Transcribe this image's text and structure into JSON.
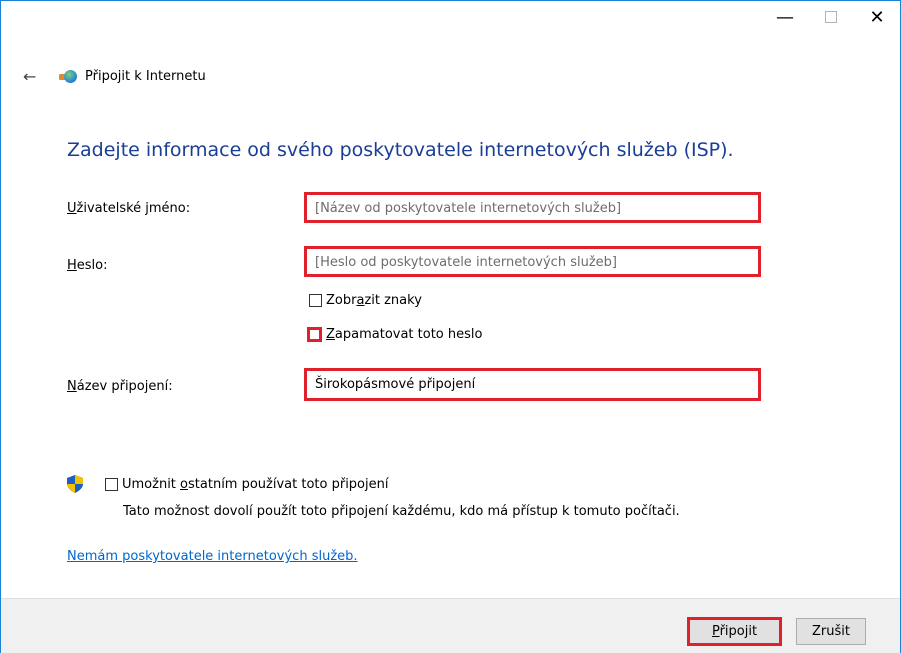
{
  "window": {
    "title": "Připojit k Internetu",
    "controls": {
      "minimize": "—",
      "close": "✕"
    }
  },
  "heading": "Zadejte informace od svého poskytovatele internetových služeb (ISP).",
  "form": {
    "username": {
      "label_access": "U",
      "label_rest": "živatelské jméno:",
      "placeholder": "[Název od poskytovatele internetových služeb]"
    },
    "password": {
      "label_access": "H",
      "label_rest": "eslo:",
      "placeholder": "[Heslo od poskytovatele internetových služeb]"
    },
    "show_chars": {
      "label_pre": "Zobr",
      "label_access": "a",
      "label_post": "zit znaky"
    },
    "remember": {
      "label_access": "Z",
      "label_post": "apamatovat toto heslo"
    },
    "connection_name": {
      "label_access": "N",
      "label_rest": "ázev připojení:",
      "value": "Širokopásmové připojení"
    }
  },
  "allow_others": {
    "label_pre": "Umožnit ",
    "label_access": "o",
    "label_post": "statním používat toto připojení",
    "description": "Tato možnost dovolí použít toto připojení každému, kdo má přístup k tomuto počítači."
  },
  "no_isp_link": "Nemám poskytovatele internetových služeb.",
  "buttons": {
    "connect_access": "P",
    "connect_rest": "řipojit",
    "cancel": "Zrušit"
  },
  "colors": {
    "heading": "#1a3e96",
    "highlight": "#e0202a",
    "link": "#0066cc",
    "window_border": "#1883d7"
  }
}
